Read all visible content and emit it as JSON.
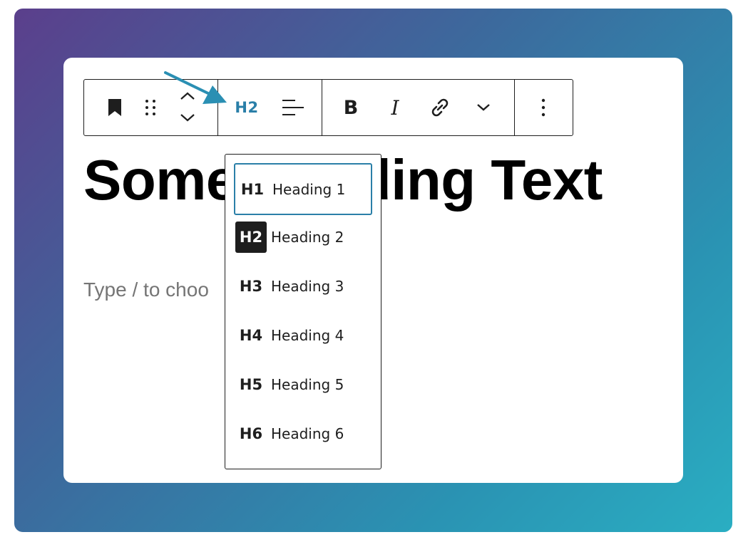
{
  "colors": {
    "accent": "#2a7fa8",
    "text": "#1e1e1e",
    "placeholder": "#757575"
  },
  "toolbar": {
    "block_icon": "bookmark-icon",
    "drag_icon": "drag-handle-icon",
    "move_icon": "move-up-down-icon",
    "heading_level_label": "H2",
    "align_icon": "align-left-icon",
    "bold_label": "B",
    "italic_label": "I",
    "link_icon": "link-icon",
    "more_icon": "chevron-down-icon",
    "options_icon": "more-vertical-icon"
  },
  "editor": {
    "heading_text": "Some Heading Text",
    "placeholder": "Type / to choo"
  },
  "heading_menu": {
    "items": [
      {
        "badge": "H1",
        "label": "Heading 1"
      },
      {
        "badge": "H2",
        "label": "Heading 2"
      },
      {
        "badge": "H3",
        "label": "Heading 3"
      },
      {
        "badge": "H4",
        "label": "Heading 4"
      },
      {
        "badge": "H5",
        "label": "Heading 5"
      },
      {
        "badge": "H6",
        "label": "Heading 6"
      }
    ],
    "focused_index": 0,
    "active_index": 1
  }
}
